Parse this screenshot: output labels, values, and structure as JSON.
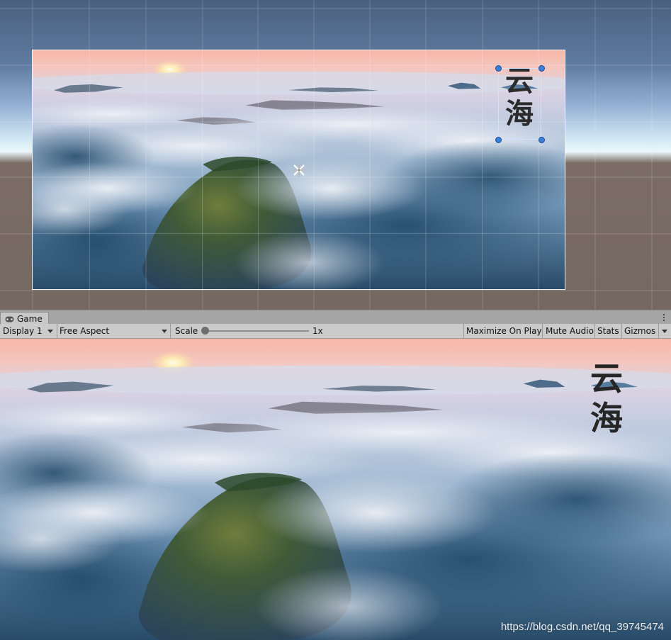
{
  "game_tab": {
    "label": "Game",
    "icon": "gamepad-icon"
  },
  "toolbar": {
    "display": "Display 1",
    "aspect": "Free Aspect",
    "scale_label": "Scale",
    "scale_value": "1x",
    "maximize_on_play": "Maximize On Play",
    "mute_audio": "Mute Audio",
    "stats": "Stats",
    "gizmos": "Gizmos"
  },
  "ui_text": {
    "title_line1": "云",
    "title_line2": "海"
  },
  "watermark": "https://blog.csdn.net/qq_39745474",
  "colors": {
    "scene_sky_top": "#4a607f",
    "toolbar_bg": "#cbcbcb",
    "tab_bg": "#c8c8c8",
    "handle_blue": "#3b7fd8"
  }
}
